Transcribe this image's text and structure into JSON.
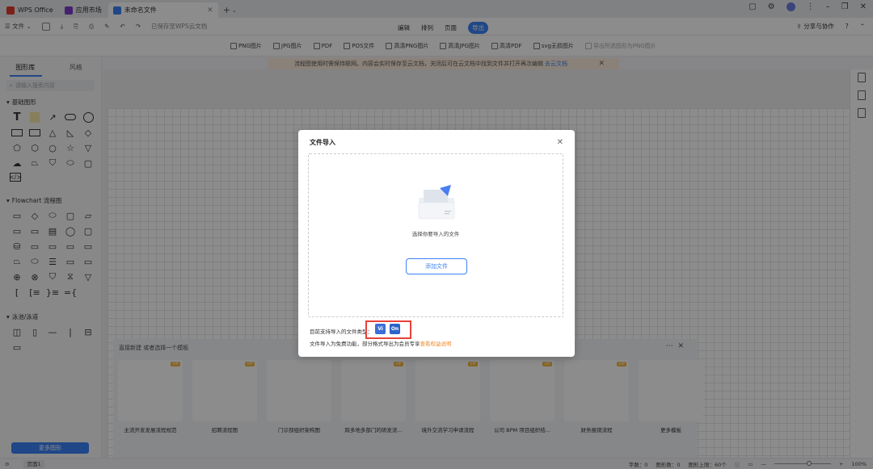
{
  "tabs": [
    {
      "label": "WPS Office",
      "color": "#e03a2f"
    },
    {
      "label": "应用市场",
      "color": "#7a3cc8"
    },
    {
      "label": "未命名文件",
      "color": "#3b82f6"
    }
  ],
  "toolbar": {
    "file_label": "文件",
    "saved_status": "已保存至WPS云文档",
    "center_tabs": [
      "编辑",
      "排列",
      "页面",
      "导出"
    ],
    "active_center_tab": "导出",
    "share_label": "分享与协作",
    "help_label": "?"
  },
  "export_bar": {
    "items": [
      "PNG图片",
      "JPG图片",
      "PDF",
      "POS文件",
      "高清PNG图片",
      "高清JPG图片",
      "高清PDF",
      "svg无损图片"
    ],
    "disabled_item": "导出所选图形为PNG图片"
  },
  "notice": {
    "text": "流程图使用时需保持联网。内容会实时保存至云文档，关闭后可在云文档中找到文件并打开再次编辑",
    "link": "去云文档"
  },
  "sidebar": {
    "tabs": [
      "图形库",
      "风格"
    ],
    "search_placeholder": "请输入搜索内容",
    "sections": [
      "基础图形",
      "Flowchart 流程图",
      "泳池/泳道"
    ],
    "more_button": "更多图形"
  },
  "templates": {
    "heading": "直接新建 或者选择一个模板",
    "vip_label": "VIP",
    "items": [
      "主流开发发展流程规范",
      "招聘流程图",
      "门诊部组织架构图",
      "跨多地多部门的研发流...",
      "境外交流学习申请流程",
      "公司 BPM 项目组织结...",
      "财务报销流程",
      "更多模板"
    ]
  },
  "modal": {
    "title": "文件导入",
    "close_icon": "close-icon",
    "dropzone_text": "选择你要导入的文件",
    "add_button": "添加文件",
    "supported_label": "目前支持导入的文件类型：",
    "file_types": [
      "Vi",
      "On"
    ],
    "free_note": "文件导入为免费功能，部分格式导出为会员专享",
    "free_link": "查看权益说明"
  },
  "statusbar": {
    "page_tab": "页面1",
    "word_count": "字数：0",
    "shape_count": "图形数：0",
    "shape_limit": "图形上限：60个",
    "zoom": "100%"
  }
}
